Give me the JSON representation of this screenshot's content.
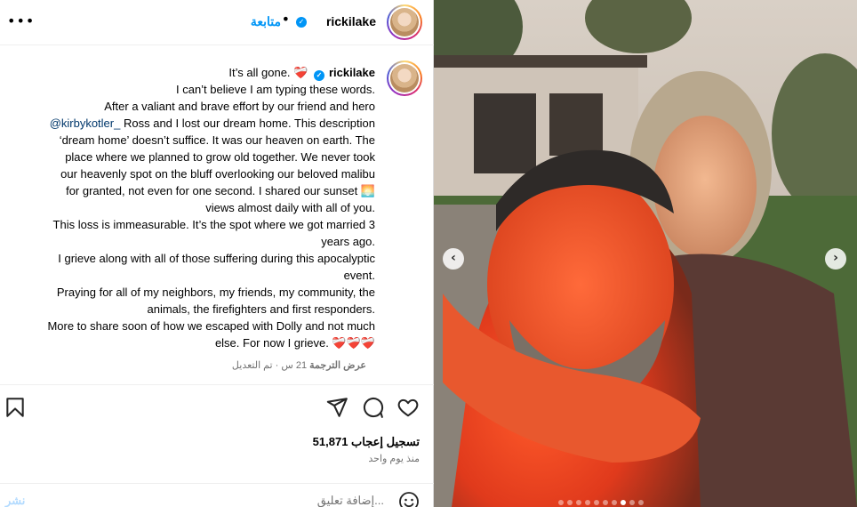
{
  "header": {
    "username": "rickilake",
    "follow_label": "متابعة",
    "separator": "•",
    "more_label": "•••"
  },
  "caption": {
    "username": "rickilake",
    "lines": [
      "It’s all gone. ❤️‍🩹",
      "I can’t believe I am typing these words.",
      "After a valiant and brave effort by our friend and hero",
      "Ross and I lost our dream home. This description",
      "‘dream home’ doesn’t suffice. It was our heaven on earth. The",
      "place where we planned to grow old together. We never took",
      "our heavenly spot on the bluff overlooking our beloved malibu",
      "for granted, not even for one second. I shared our sunset 🌅",
      "views almost daily with all of you.",
      "This loss is immeasurable. It’s the spot where we got married 3",
      "years ago.",
      "I grieve along with all of those suffering during this apocalyptic",
      "event.",
      "Praying for all of my neighbors, my friends, my community, the",
      "animals, the firefighters and first responders.",
      "More to share soon of how we escaped with Dolly and not much",
      "else. For now I grieve. ❤️‍🩹❤️‍🩹❤️‍🩹"
    ],
    "mention": "@kirbykotler_",
    "edited_label": "تم التعديل",
    "time_label": "21 س",
    "meta_separator": "·",
    "translate_label": "عرض الترجمة"
  },
  "actions": {
    "likes_text": "51,871 تسجيل إعجاب",
    "posted_ago": "منذ يوم واحد"
  },
  "comment": {
    "placeholder": "إضافة تعليق...",
    "post_label": "نشر"
  },
  "carousel": {
    "prev_label": "‹",
    "next_label": "›",
    "slide_count": 10,
    "active_slide": 7
  }
}
